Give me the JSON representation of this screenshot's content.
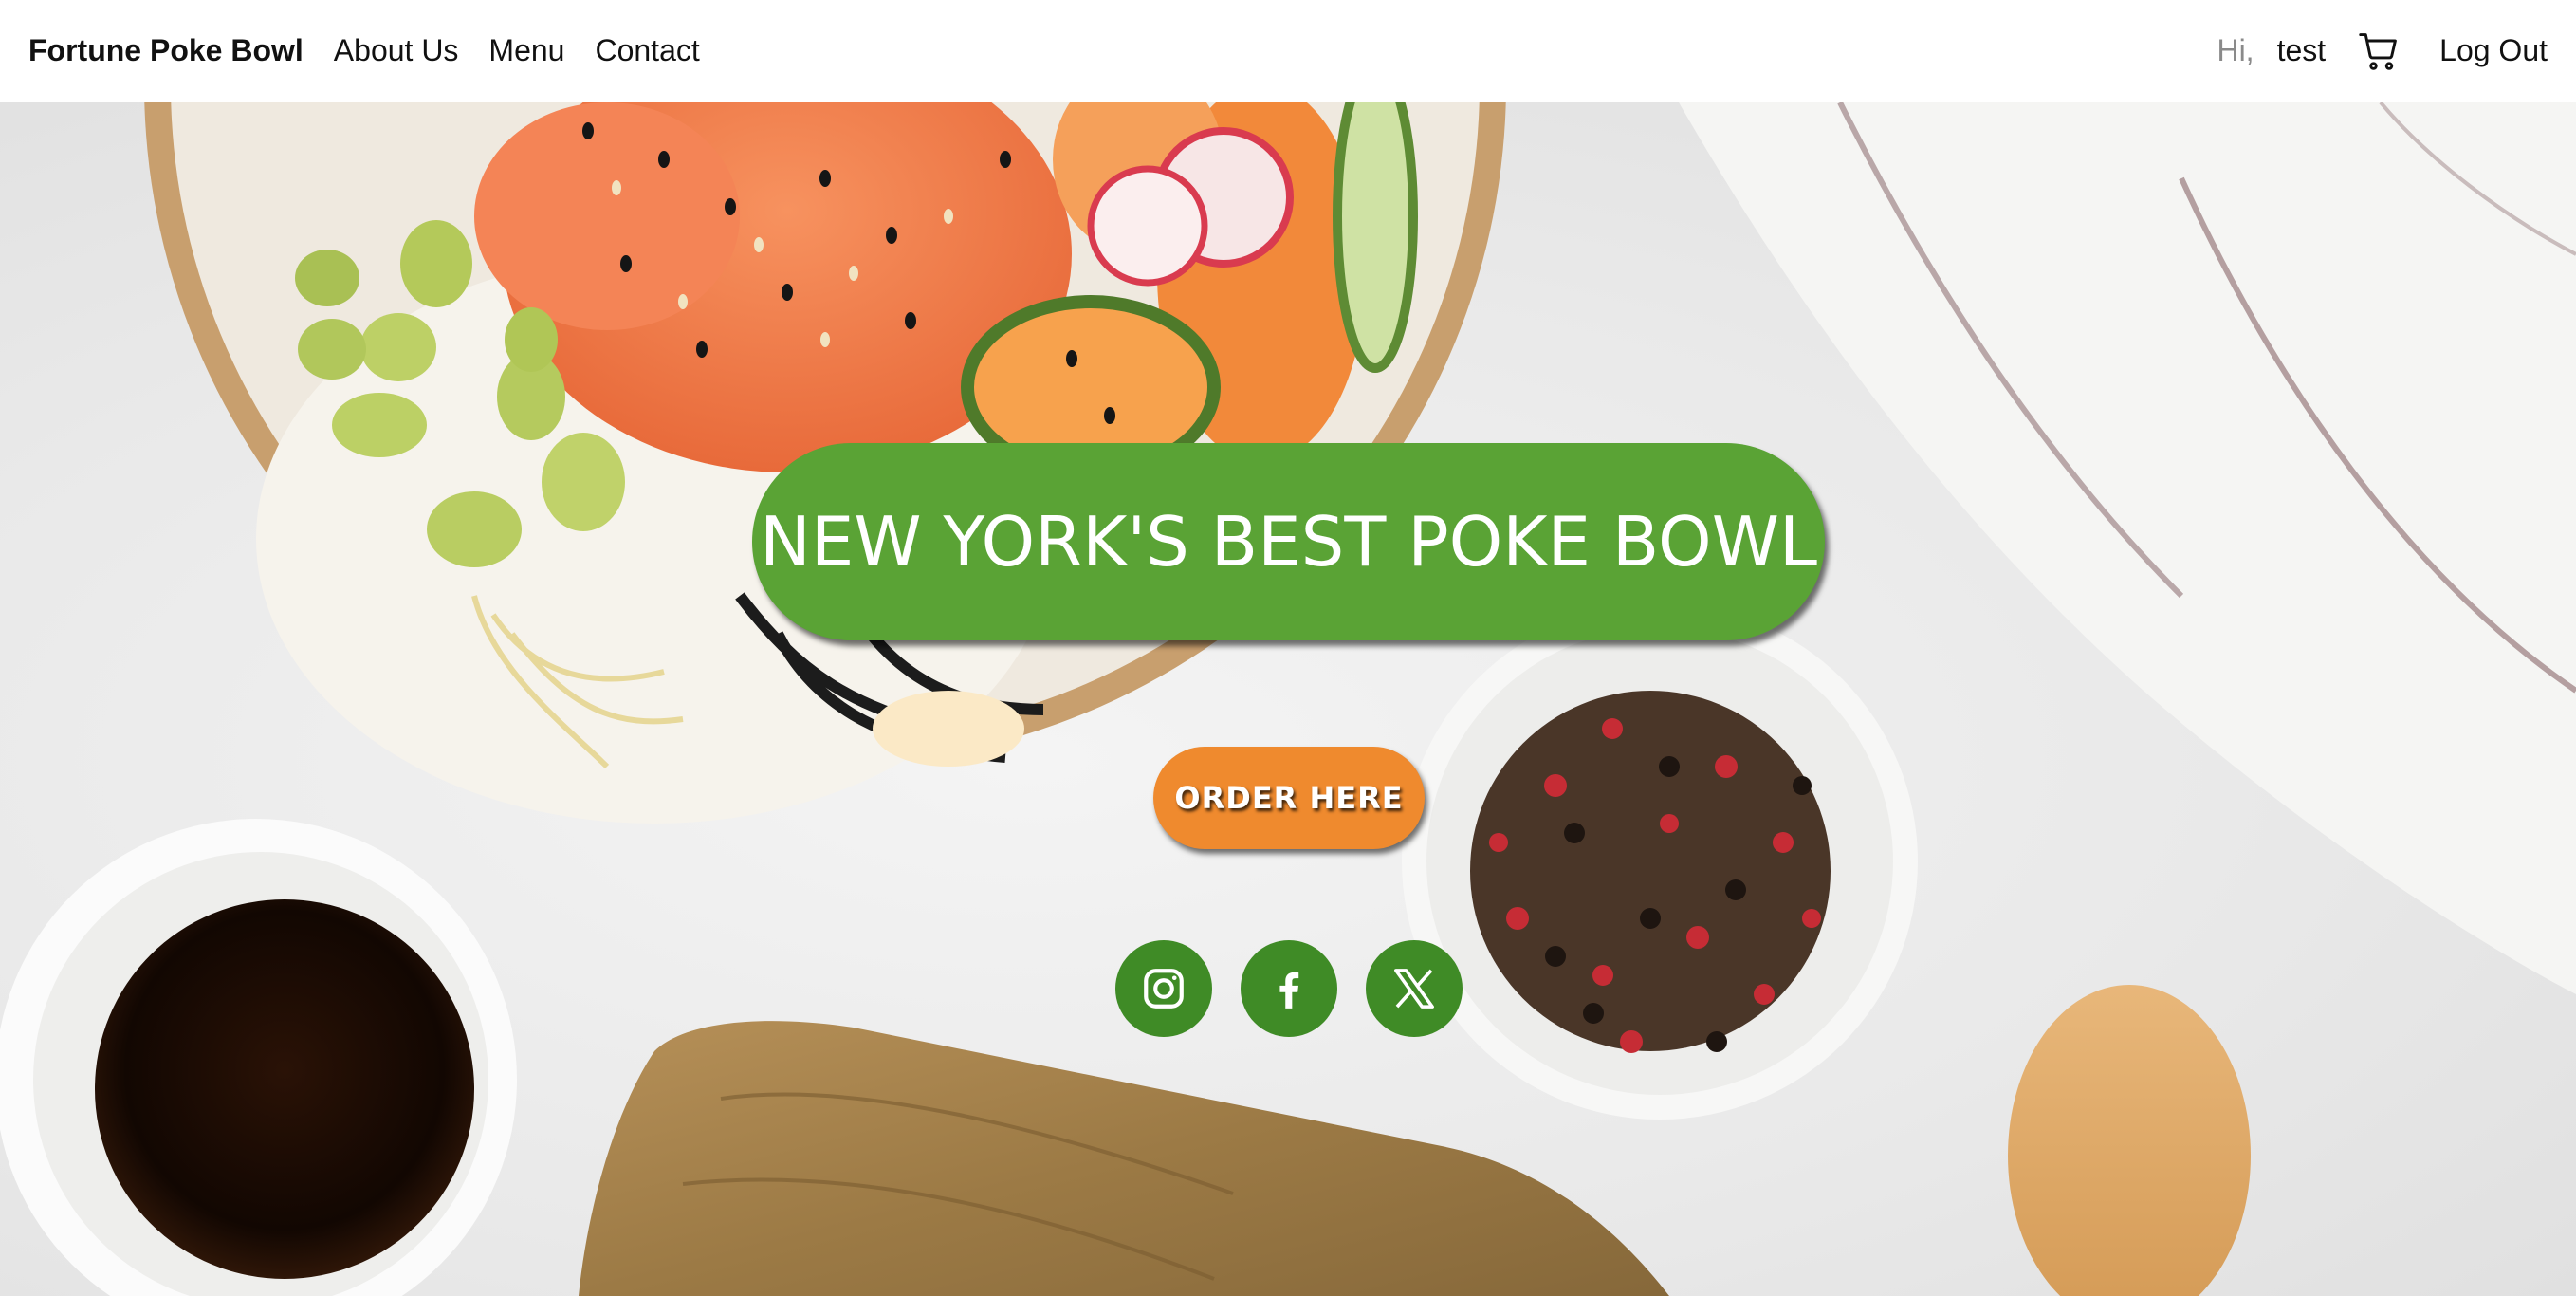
{
  "nav": {
    "brand": "Fortune Poke Bowl",
    "links": [
      "About Us",
      "Menu",
      "Contact"
    ],
    "greeting": "Hi,",
    "username": "test",
    "cart_icon": "cart-icon",
    "logout": "Log Out"
  },
  "hero": {
    "headline": "NEW YORK'S BEST POKE BOWL",
    "order_button": "ORDER HERE",
    "social": [
      "instagram-icon",
      "facebook-icon",
      "x-icon"
    ]
  },
  "colors": {
    "headline_bg": "#5aa335",
    "order_bg": "#ef8a2e",
    "social_bg": "#3f8b26"
  }
}
